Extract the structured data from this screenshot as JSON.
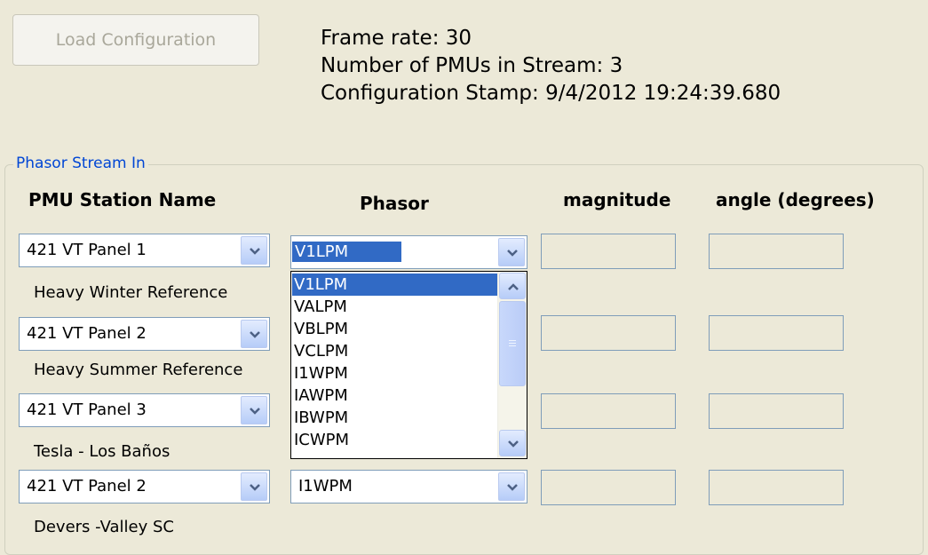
{
  "toolbar": {
    "load_config_label": "Load Configuration"
  },
  "info": {
    "frame_rate": "Frame rate: 30",
    "pmu_count": "Number of PMUs in Stream: 3",
    "config_stamp": "Configuration Stamp: 9/4/2012 19:24:39.680"
  },
  "group": {
    "title": "Phasor Stream In",
    "headers": {
      "station": "PMU Station Name",
      "phasor": "Phasor",
      "magnitude": "magnitude",
      "angle": "angle (degrees)"
    }
  },
  "rows": [
    {
      "station": "421 VT Panel 1",
      "phasor": "V1LPM",
      "magnitude": "",
      "angle": "",
      "description": "Heavy Winter Reference"
    },
    {
      "station": "421 VT Panel 2",
      "phasor": "",
      "magnitude": "",
      "angle": "",
      "description": "Heavy Summer Reference"
    },
    {
      "station": "421 VT Panel 3",
      "phasor": "",
      "magnitude": "",
      "angle": "",
      "description": "Tesla - Los Baños"
    },
    {
      "station": "421 VT Panel 2",
      "phasor": "I1WPM",
      "magnitude": "",
      "angle": "",
      "description": "Devers -Valley SC"
    }
  ],
  "dropdown": {
    "options": [
      "V1LPM",
      "VALPM",
      "VBLPM",
      "VCLPM",
      "I1WPM",
      "IAWPM",
      "IBWPM",
      "ICWPM"
    ],
    "selected": "V1LPM"
  },
  "icons": {
    "combo_arrow": "chevron-down-icon",
    "scroll_up": "chevron-up-icon",
    "scroll_down": "chevron-down-icon",
    "scroll_grip": "grip-icon"
  },
  "colors": {
    "background": "#ECE9D8",
    "selection": "#316AC5",
    "group_title": "#0046D5",
    "field_border": "#7F9DB9"
  }
}
